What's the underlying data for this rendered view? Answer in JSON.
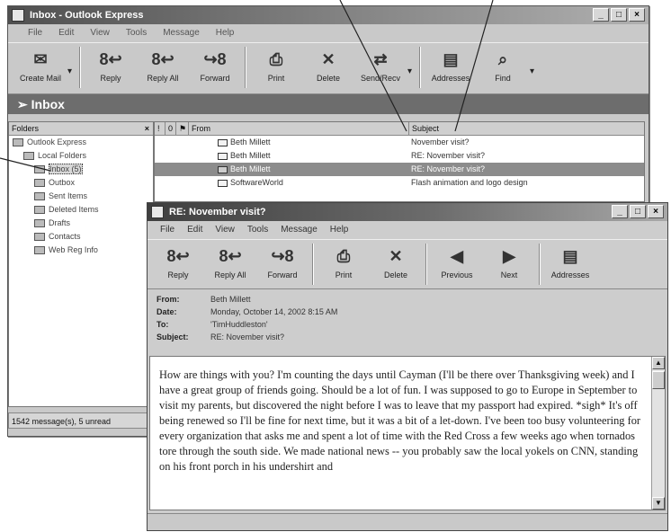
{
  "main_window": {
    "title": "Inbox - Outlook Express",
    "menu": [
      "File",
      "Edit",
      "View",
      "Tools",
      "Message",
      "Help"
    ],
    "toolbar": [
      {
        "label": "Create Mail",
        "icon": "create-mail-icon",
        "glyph": "✉"
      },
      {
        "label": "Reply",
        "icon": "reply-icon",
        "glyph": "8↩"
      },
      {
        "label": "Reply All",
        "icon": "reply-all-icon",
        "glyph": "8↩"
      },
      {
        "label": "Forward",
        "icon": "forward-icon",
        "glyph": "↪8"
      },
      {
        "label": "Print",
        "icon": "print-icon",
        "glyph": "⎙"
      },
      {
        "label": "Delete",
        "icon": "delete-icon",
        "glyph": "✕"
      },
      {
        "label": "Send/Recv",
        "icon": "send-receive-icon",
        "glyph": "⇄"
      },
      {
        "label": "Addresses",
        "icon": "addresses-icon",
        "glyph": "▤"
      },
      {
        "label": "Find",
        "icon": "find-icon",
        "glyph": "⌕"
      }
    ],
    "folder_title": "Inbox",
    "folders_label": "Folders",
    "folders": [
      {
        "name": "Outlook Express",
        "indent": 0
      },
      {
        "name": "Local Folders",
        "indent": 1
      },
      {
        "name": "Inbox (5)",
        "indent": 2,
        "selected": true
      },
      {
        "name": "Outbox",
        "indent": 2
      },
      {
        "name": "Sent Items",
        "indent": 2
      },
      {
        "name": "Deleted Items",
        "indent": 2
      },
      {
        "name": "Drafts",
        "indent": 2
      },
      {
        "name": "Contacts",
        "indent": 2
      },
      {
        "name": "Web Reg Info",
        "indent": 2
      }
    ],
    "list_columns": {
      "from": "From",
      "subject": "Subject"
    },
    "messages": [
      {
        "from": "Beth Millett",
        "subject": "November visit?",
        "selected": false
      },
      {
        "from": "Beth Millett",
        "subject": "RE: November visit?",
        "selected": false
      },
      {
        "from": "Beth Millett",
        "subject": "RE: November visit?",
        "selected": true
      },
      {
        "from": "SoftwareWorld",
        "subject": "Flash animation and logo design",
        "selected": false
      }
    ],
    "status": "1542 message(s), 5 unread"
  },
  "message_window": {
    "title": "RE: November visit?",
    "menu": [
      "File",
      "Edit",
      "View",
      "Tools",
      "Message",
      "Help"
    ],
    "toolbar": [
      {
        "label": "Reply",
        "icon": "reply-icon",
        "glyph": "8↩"
      },
      {
        "label": "Reply All",
        "icon": "reply-all-icon",
        "glyph": "8↩"
      },
      {
        "label": "Forward",
        "icon": "forward-icon",
        "glyph": "↪8"
      },
      {
        "label": "Print",
        "icon": "print-icon",
        "glyph": "⎙"
      },
      {
        "label": "Delete",
        "icon": "delete-icon",
        "glyph": "✕"
      },
      {
        "label": "Previous",
        "icon": "previous-icon",
        "glyph": "◀"
      },
      {
        "label": "Next",
        "icon": "next-icon",
        "glyph": "▶"
      },
      {
        "label": "Addresses",
        "icon": "addresses-icon",
        "glyph": "▤"
      }
    ],
    "headers": {
      "from_label": "From:",
      "from": "Beth Millett",
      "date_label": "Date:",
      "date": "Monday, October 14, 2002 8:15 AM",
      "to_label": "To:",
      "to": "'TimHuddleston'",
      "subject_label": "Subject:",
      "subject": "RE: November visit?"
    },
    "body": "How are things with you? I'm counting the days until Cayman (I'll be there over Thanksgiving week) and I have a great group of friends going. Should be a lot of fun. I was supposed to go to Europe in September to visit my parents, but discovered the night before I was to leave that my passport had expired. *sigh* It's off being renewed so I'll be fine for next time, but it was a bit of a let-down. I've been too busy volunteering for every organization that asks me and spent a lot of time with the Red Cross a few weeks ago when tornados tore through the south side. We made national news -- you probably saw the local yokels on CNN, standing on his front porch in his undershirt and"
  },
  "colors": {
    "selection": "#8c8c8c",
    "titlebar_dark": "#3f3f3f",
    "chrome": "#c9c9c9"
  }
}
